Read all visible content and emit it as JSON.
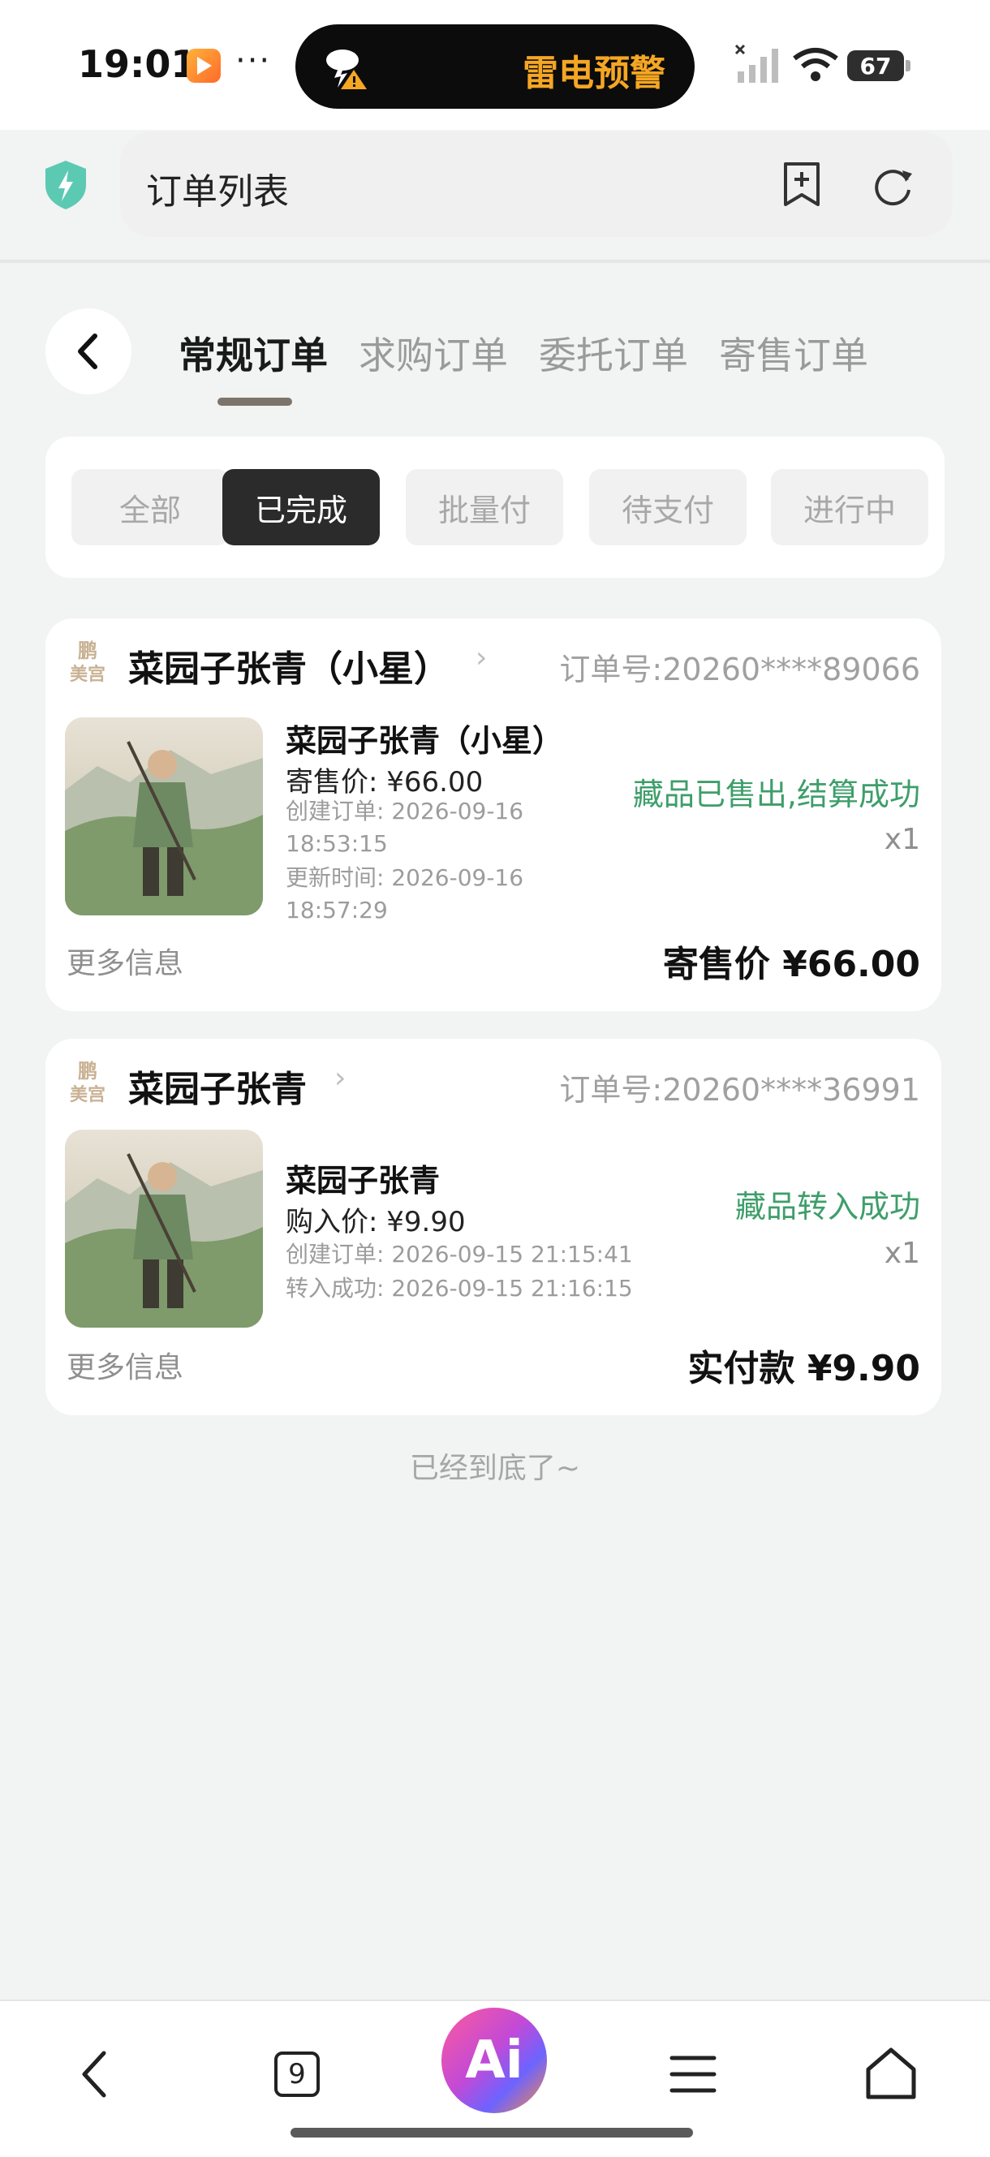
{
  "status_bar": {
    "time": "19:01",
    "dots": "···",
    "alert": "雷电预警",
    "battery": "67",
    "colors": {
      "alert": "#f5a623"
    }
  },
  "browser": {
    "url_title": "订单列表",
    "icons": [
      "shield-icon",
      "bookmark-add-icon",
      "refresh-icon"
    ]
  },
  "tabs": [
    {
      "label": "常规订单",
      "active": true
    },
    {
      "label": "求购订单",
      "active": false
    },
    {
      "label": "委托订单",
      "active": false
    },
    {
      "label": "寄售订单",
      "active": false
    }
  ],
  "filters": [
    {
      "label": "全部",
      "active": false
    },
    {
      "label": "已完成",
      "active": true
    },
    {
      "label": "批量付",
      "active": false
    },
    {
      "label": "待支付",
      "active": false
    },
    {
      "label": "进行中",
      "active": false
    }
  ],
  "orders": [
    {
      "store_logo": "鹏\n美宫",
      "store_name": "菜园子张青（小星）",
      "order_no": "订单号:20260****89066",
      "title": "菜园子张青（小星）",
      "price": "寄售价: ¥66.00",
      "meta1": "创建订单: 2026-09-16 18:53:15",
      "meta2": "更新时间: 2026-09-16 18:57:29",
      "status": "藏品已售出,结算成功",
      "qty": "x1",
      "more": "更多信息",
      "total": "寄售价 ¥66.00"
    },
    {
      "store_logo": "鹏\n美宫",
      "store_name": "菜园子张青",
      "order_no": "订单号:20260****36991",
      "title": "菜园子张青",
      "price": "购入价: ¥9.90",
      "meta1": "创建订单: 2026-09-15 21:15:41",
      "meta2": "转入成功: 2026-09-15 21:16:15",
      "status": "藏品转入成功",
      "qty": "x1",
      "more": "更多信息",
      "total": "实付款 ¥9.90"
    }
  ],
  "end_text": "已经到底了~",
  "bottom_nav": {
    "tab_count": "9",
    "ai_label": "Ai"
  }
}
